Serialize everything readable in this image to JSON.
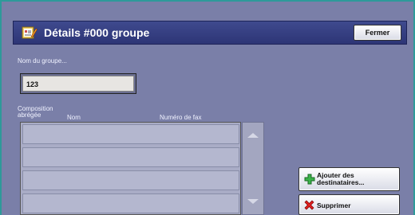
{
  "header": {
    "title": "Détails #000 groupe",
    "close_label": "Fermer"
  },
  "group_name": {
    "label": "Nom du groupe...",
    "value": "123"
  },
  "members": {
    "label_line1": "Composition",
    "label_line2": "abrégée",
    "col_name": "Nom",
    "col_fax": "Numéro de fax",
    "rows": [
      "",
      "",
      "",
      ""
    ]
  },
  "actions": {
    "add_label_line1": "Ajouter des",
    "add_label_line2": "destinataires...",
    "delete_label": "Supprimer"
  },
  "icons": {
    "title": "address-book-icon",
    "add": "green-plus-icon",
    "delete": "red-x-icon"
  },
  "colors": {
    "background": "#7a7fa8",
    "title_bar": "#2d3576",
    "accent_border": "#2e9a9a"
  }
}
